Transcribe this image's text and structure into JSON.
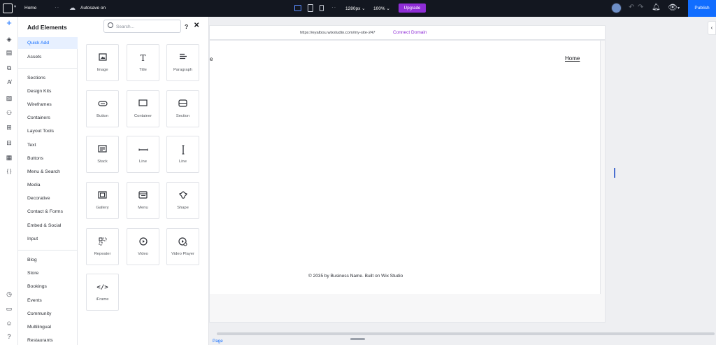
{
  "topbar": {
    "home_label": "Home",
    "autosave_label": "Autosave on",
    "width_label": "1280px ⌄",
    "zoom_label": "100% ⌄",
    "upgrade_label": "Upgrade",
    "publish_label": "Publish"
  },
  "panel": {
    "title": "Add Elements",
    "search_placeholder": "Search...",
    "help_label": "?",
    "close_label": "✕",
    "categories_group1": [
      "Quick Add",
      "Assets"
    ],
    "categories_group2": [
      "Sections",
      "Design Kits",
      "Wireframes",
      "Containers",
      "Layout Tools",
      "Text",
      "Buttons",
      "Menu & Search",
      "Media",
      "Decorative",
      "Contact & Forms",
      "Embed & Social",
      "Input"
    ],
    "categories_group3": [
      "Blog",
      "Store",
      "Bookings",
      "Events",
      "Community",
      "Multilingual",
      "Restaurants"
    ],
    "tiles": [
      {
        "label": "Image",
        "icon": "image-icon"
      },
      {
        "label": "Title",
        "icon": "title-icon"
      },
      {
        "label": "Paragraph",
        "icon": "paragraph-icon"
      },
      {
        "label": "Button",
        "icon": "button-icon"
      },
      {
        "label": "Container",
        "icon": "container-icon"
      },
      {
        "label": "Section",
        "icon": "section-icon"
      },
      {
        "label": "Stack",
        "icon": "stack-icon"
      },
      {
        "label": "Line",
        "icon": "horizontal-line-icon"
      },
      {
        "label": "Line",
        "icon": "vertical-line-icon"
      },
      {
        "label": "Gallery",
        "icon": "gallery-icon"
      },
      {
        "label": "Menu",
        "icon": "menu-icon"
      },
      {
        "label": "Shape",
        "icon": "shape-icon"
      },
      {
        "label": "Repeater",
        "icon": "repeater-icon"
      },
      {
        "label": "Video",
        "icon": "video-icon"
      },
      {
        "label": "Video Player",
        "icon": "video-player-icon"
      },
      {
        "label": "iFrame",
        "icon": "code-icon"
      }
    ]
  },
  "canvas": {
    "url": "https://eyalbou.wixstudio.com/my-site-247",
    "connect_domain": "Connect Domain",
    "header_fragment": "e",
    "nav_home": "Home",
    "footer": "© 2035 by Business Name. Built on Wix Studio",
    "page_tag": "Page"
  },
  "colors": {
    "accent": "#116dff",
    "upgrade": "#8f2dd6",
    "topbar_bg": "#131720"
  }
}
